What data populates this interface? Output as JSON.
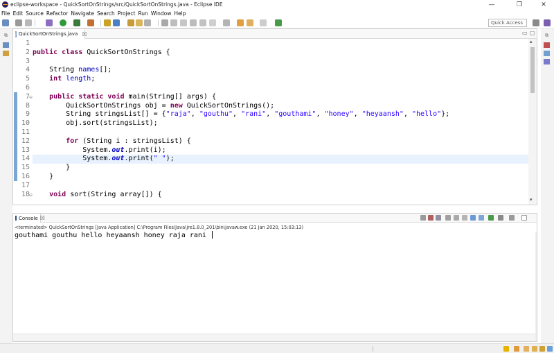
{
  "window": {
    "title": "eclipse-workspace - QuickSortOnStrings/src/QuickSortOnStrings.java - Eclipse IDE",
    "minimize": "—",
    "maximize": "❐",
    "close": "✕"
  },
  "menu": [
    "File",
    "Edit",
    "Source",
    "Refactor",
    "Navigate",
    "Search",
    "Project",
    "Run",
    "Window",
    "Help"
  ],
  "toolbar": {
    "quick_access_placeholder": "Quick Access"
  },
  "editor": {
    "tab_label": "QuickSortOnStrings.java",
    "tab_close": "☒",
    "current_line": 14,
    "lines": [
      {
        "n": "1",
        "tokens": []
      },
      {
        "n": "2",
        "tokens": [
          {
            "t": "public",
            "c": "kw"
          },
          {
            "t": " "
          },
          {
            "t": "class",
            "c": "kw"
          },
          {
            "t": " QuickSortOnStrings {"
          }
        ]
      },
      {
        "n": "3",
        "tokens": []
      },
      {
        "n": "4",
        "tokens": [
          {
            "t": "    String "
          },
          {
            "t": "names",
            "c": "fld"
          },
          {
            "t": "[];"
          }
        ]
      },
      {
        "n": "5",
        "tokens": [
          {
            "t": "    "
          },
          {
            "t": "int",
            "c": "kw"
          },
          {
            "t": " "
          },
          {
            "t": "length",
            "c": "fld"
          },
          {
            "t": ";"
          }
        ]
      },
      {
        "n": "6",
        "tokens": []
      },
      {
        "n": "7",
        "fold": "⊖",
        "tokens": [
          {
            "t": "    "
          },
          {
            "t": "public",
            "c": "kw"
          },
          {
            "t": " "
          },
          {
            "t": "static",
            "c": "kw"
          },
          {
            "t": " "
          },
          {
            "t": "void",
            "c": "kw"
          },
          {
            "t": " main(String[] "
          },
          {
            "t": "args",
            "c": "var"
          },
          {
            "t": ") {"
          }
        ]
      },
      {
        "n": "8",
        "tokens": [
          {
            "t": "        QuickSortOnStrings "
          },
          {
            "t": "obj",
            "c": "var"
          },
          {
            "t": " = "
          },
          {
            "t": "new",
            "c": "kw"
          },
          {
            "t": " QuickSortOnStrings();"
          }
        ]
      },
      {
        "n": "9",
        "tokens": [
          {
            "t": "        String "
          },
          {
            "t": "stringsList",
            "c": "var"
          },
          {
            "t": "[] = {"
          },
          {
            "t": "\"raja\"",
            "c": "str"
          },
          {
            "t": ", "
          },
          {
            "t": "\"gouthu\"",
            "c": "str"
          },
          {
            "t": ", "
          },
          {
            "t": "\"rani\"",
            "c": "str"
          },
          {
            "t": ", "
          },
          {
            "t": "\"gouthami\"",
            "c": "str"
          },
          {
            "t": ", "
          },
          {
            "t": "\"honey\"",
            "c": "str"
          },
          {
            "t": ", "
          },
          {
            "t": "\"heyaansh\"",
            "c": "str"
          },
          {
            "t": ", "
          },
          {
            "t": "\"hello\"",
            "c": "str"
          },
          {
            "t": "};"
          }
        ]
      },
      {
        "n": "10",
        "tokens": [
          {
            "t": "        obj.sort(stringsList);"
          }
        ]
      },
      {
        "n": "11",
        "tokens": []
      },
      {
        "n": "12",
        "tokens": [
          {
            "t": "        "
          },
          {
            "t": "for",
            "c": "kw"
          },
          {
            "t": " (String "
          },
          {
            "t": "i",
            "c": "var"
          },
          {
            "t": " : stringsList) {"
          }
        ]
      },
      {
        "n": "13",
        "tokens": [
          {
            "t": "            System."
          },
          {
            "t": "out",
            "c": "sfld"
          },
          {
            "t": ".print(i);"
          }
        ]
      },
      {
        "n": "14",
        "tokens": [
          {
            "t": "            System."
          },
          {
            "t": "out",
            "c": "sfld"
          },
          {
            "t": ".print("
          },
          {
            "t": "\" \"",
            "c": "str"
          },
          {
            "t": ");"
          }
        ]
      },
      {
        "n": "15",
        "tokens": [
          {
            "t": "        }"
          }
        ]
      },
      {
        "n": "16",
        "tokens": [
          {
            "t": "    }"
          }
        ]
      },
      {
        "n": "17",
        "tokens": []
      },
      {
        "n": "18",
        "fold": "⊖",
        "tokens": [
          {
            "t": "    "
          },
          {
            "t": "void",
            "c": "kw"
          },
          {
            "t": " sort(String "
          },
          {
            "t": "array",
            "c": "var"
          },
          {
            "t": "[]) {"
          }
        ]
      }
    ]
  },
  "console": {
    "tab_label": "Console",
    "tab_close": "☒",
    "terminated_line": "<terminated> QuickSortOnStrings [Java Application] C:\\Program Files\\Java\\jre1.8.0_201\\bin\\javaw.exe (21 Jan 2020, 15:03:13)",
    "output": "gouthami gouthu hello heyaansh honey raja rani "
  },
  "colors": {
    "keyword": "#7f0055",
    "field": "#0000c0",
    "string": "#2a00ff",
    "current_line": "#e8f2fe",
    "change_bar": "#7aa6d6"
  }
}
